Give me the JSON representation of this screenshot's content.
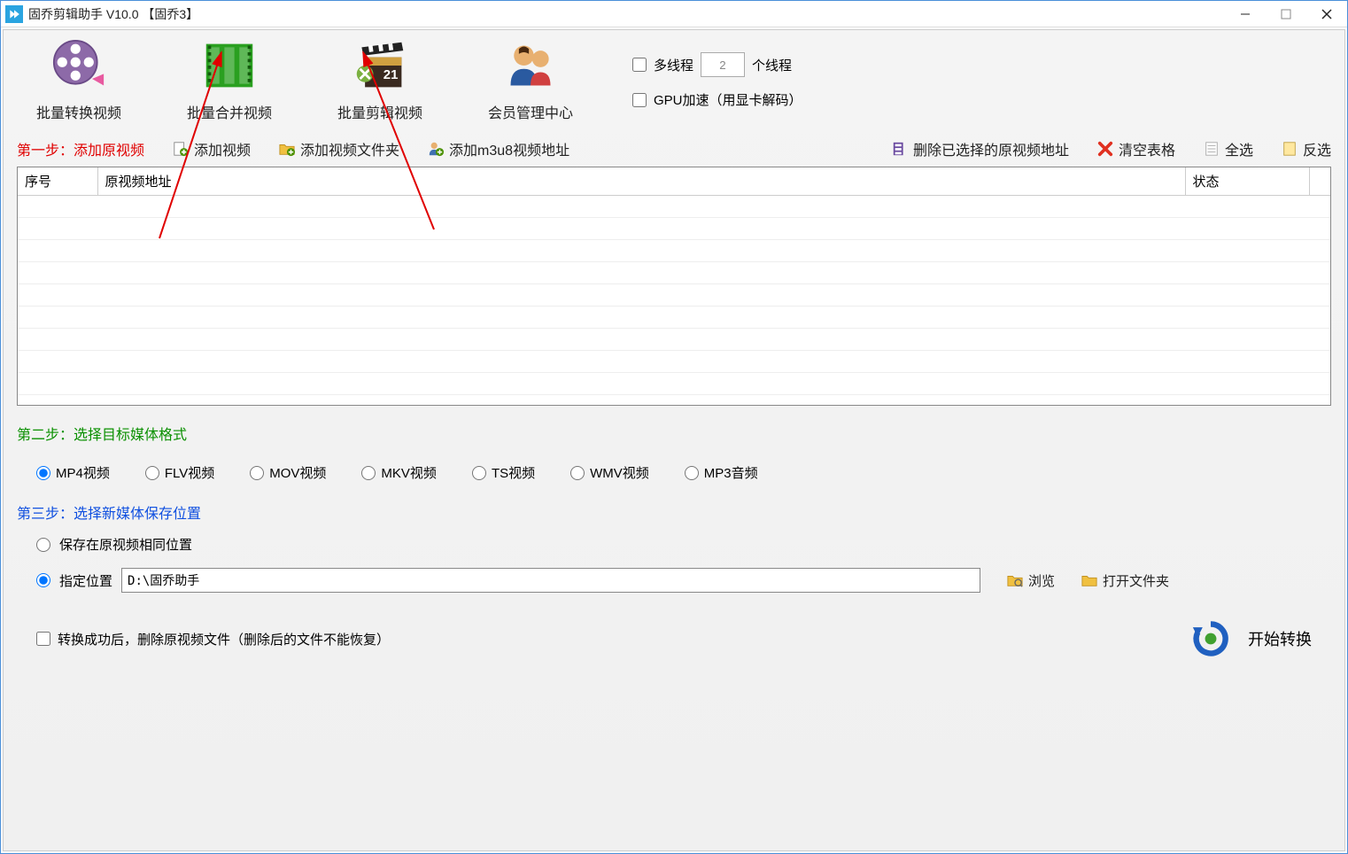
{
  "window": {
    "title": "固乔剪辑助手 V10.0 【固乔3】"
  },
  "toolbar": {
    "convert": "批量转换视频",
    "merge": "批量合并视频",
    "edit": "批量剪辑视频",
    "member": "会员管理中心"
  },
  "threads": {
    "multithread_label": "多线程",
    "thread_count": "2",
    "thread_unit": "个线程",
    "gpu_label": "GPU加速（用显卡解码）"
  },
  "step1": {
    "label": "第一步：添加原视频",
    "add_video": "添加视频",
    "add_folder": "添加视频文件夹",
    "add_m3u8": "添加m3u8视频地址",
    "remove_selected": "删除已选择的原视频地址",
    "clear_table": "清空表格",
    "select_all": "全选",
    "invert_select": "反选"
  },
  "table": {
    "col_seq": "序号",
    "col_addr": "原视频地址",
    "col_status": "状态"
  },
  "step2": {
    "label": "第二步：选择目标媒体格式",
    "formats": [
      {
        "key": "mp4",
        "label": "MP4视频",
        "checked": true
      },
      {
        "key": "flv",
        "label": "FLV视频",
        "checked": false
      },
      {
        "key": "mov",
        "label": "MOV视频",
        "checked": false
      },
      {
        "key": "mkv",
        "label": "MKV视频",
        "checked": false
      },
      {
        "key": "ts",
        "label": "TS视频",
        "checked": false
      },
      {
        "key": "wmv",
        "label": "WMV视频",
        "checked": false
      },
      {
        "key": "mp3",
        "label": "MP3音频",
        "checked": false
      }
    ]
  },
  "step3": {
    "label": "第三步：选择新媒体保存位置",
    "same_loc_label": "保存在原视频相同位置",
    "custom_loc_label": "指定位置",
    "path": "D:\\固乔助手",
    "browse": "浏览",
    "open_folder": "打开文件夹"
  },
  "bottom": {
    "delete_after_label": "转换成功后，删除原视频文件（删除后的文件不能恢复）",
    "start_label": "开始转换"
  }
}
